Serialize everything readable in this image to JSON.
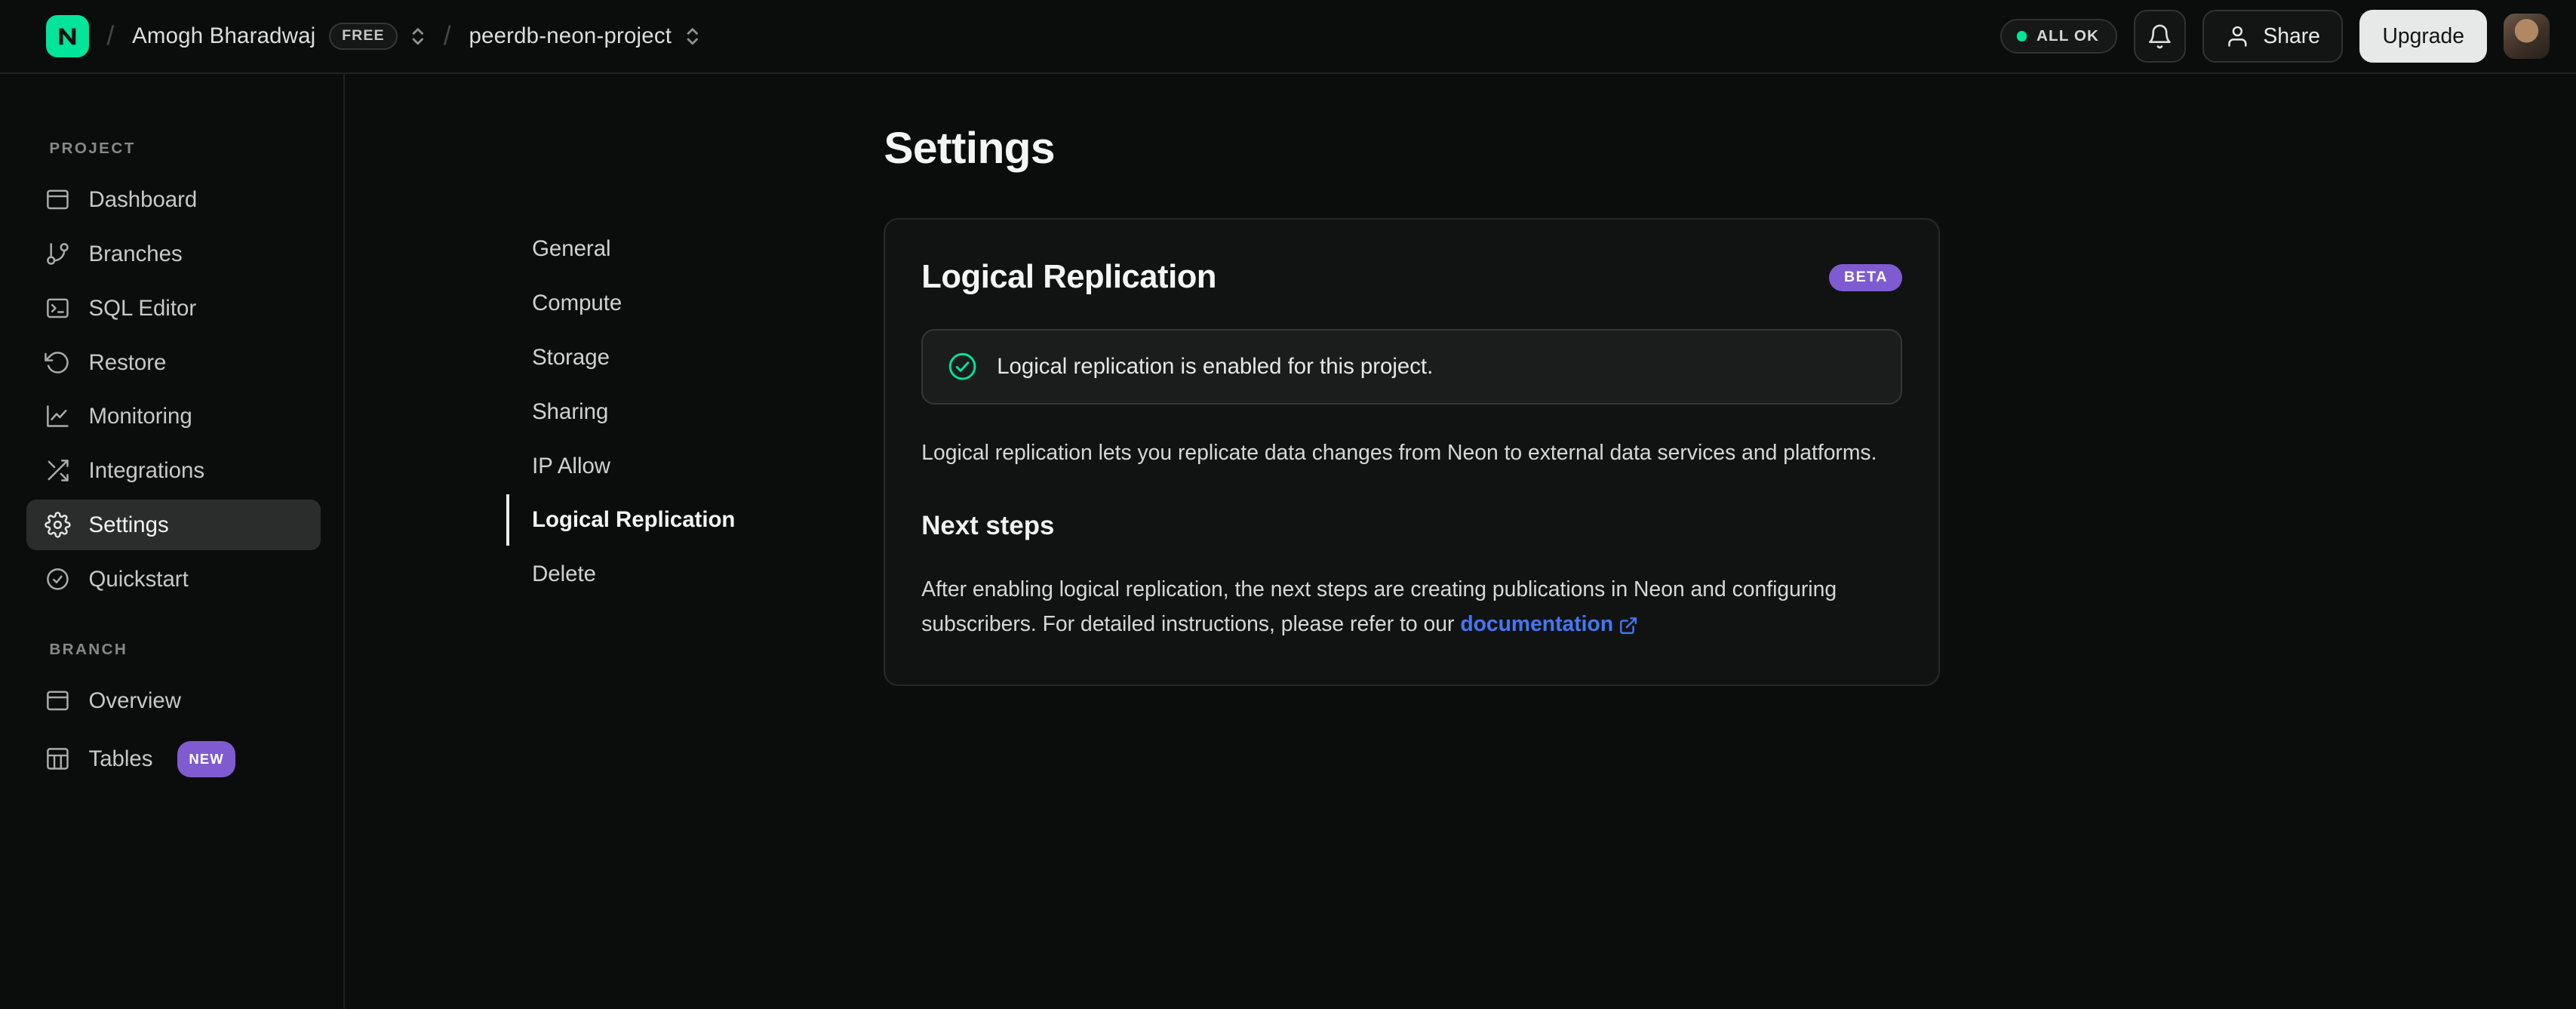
{
  "topbar": {
    "org_name": "Amogh Bharadwaj",
    "org_plan_badge": "FREE",
    "project_name": "peerdb-neon-project",
    "status_label": "ALL OK",
    "share_label": "Share",
    "upgrade_label": "Upgrade"
  },
  "sidebar": {
    "sections": [
      {
        "label": "PROJECT",
        "items": [
          {
            "label": "Dashboard",
            "icon": "dashboard-icon"
          },
          {
            "label": "Branches",
            "icon": "branches-icon"
          },
          {
            "label": "SQL Editor",
            "icon": "sql-editor-icon"
          },
          {
            "label": "Restore",
            "icon": "restore-icon"
          },
          {
            "label": "Monitoring",
            "icon": "monitoring-icon"
          },
          {
            "label": "Integrations",
            "icon": "integrations-icon"
          },
          {
            "label": "Settings",
            "icon": "settings-icon",
            "active": true
          },
          {
            "label": "Quickstart",
            "icon": "quickstart-icon"
          }
        ]
      },
      {
        "label": "BRANCH",
        "items": [
          {
            "label": "Overview",
            "icon": "overview-icon"
          },
          {
            "label": "Tables",
            "icon": "tables-icon",
            "badge": "NEW"
          }
        ]
      }
    ]
  },
  "settings_nav": {
    "items": [
      "General",
      "Compute",
      "Storage",
      "Sharing",
      "IP Allow",
      "Logical Replication",
      "Delete"
    ],
    "active_item": "Logical Replication"
  },
  "main": {
    "page_title": "Settings",
    "card": {
      "title": "Logical Replication",
      "beta_badge": "BETA",
      "banner_text": "Logical replication is enabled for this project.",
      "description": "Logical replication lets you replicate data changes from Neon to external data services and platforms.",
      "next_steps_title": "Next steps",
      "next_steps_text": "After enabling logical replication, the next steps are creating publications in Neon and configuring subscribers. For detailed instructions, please refer to our",
      "doc_link_label": "documentation"
    }
  },
  "colors": {
    "accent_green": "#00e599",
    "status_ok_green": "#00e599",
    "badge_purple": "#7f5bd1",
    "link_blue": "#4576f5"
  }
}
